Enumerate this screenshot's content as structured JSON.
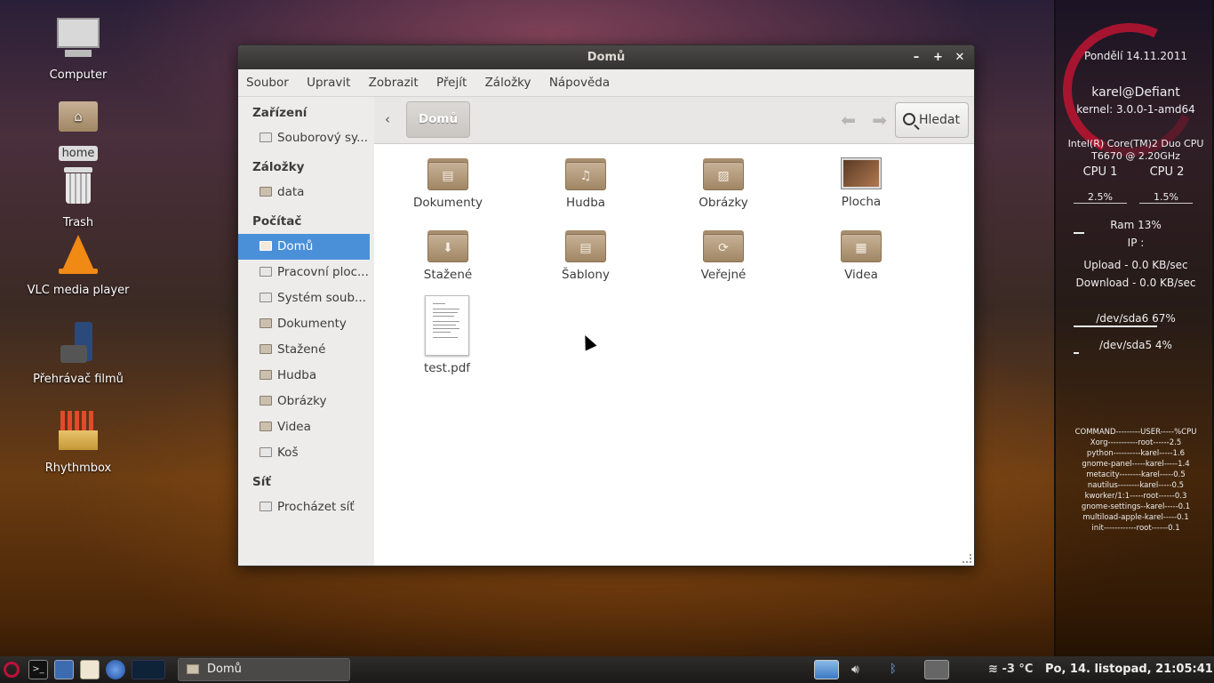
{
  "desktop": {
    "icons": [
      {
        "label": "Computer"
      },
      {
        "label": "home"
      },
      {
        "label": "Trash"
      },
      {
        "label": "VLC media player"
      },
      {
        "label": "Přehrávač filmů"
      },
      {
        "label": "Rhythmbox"
      }
    ]
  },
  "conky": {
    "date": "Pondělí 14.11.2011",
    "user": "karel@Defiant",
    "kernel": "kernel: 3.0.0-1-amd64",
    "cpu_model_line1": "Intel(R) Core(TM)2 Duo CPU",
    "cpu_model_line2": "T6670  @ 2.20GHz",
    "cpu1_label": "CPU 1",
    "cpu2_label": "CPU 2",
    "cpu1_value": "2.5%",
    "cpu2_value": "1.5%",
    "ram": "Ram 13%",
    "ram_fraction": 0.13,
    "ip": "IP :",
    "upload": "Upload - 0.0 KB/sec",
    "download": "Download - 0.0 KB/sec",
    "sda6": "/dev/sda6 67%",
    "sda6_fraction": 0.67,
    "sda5": "/dev/sda5 4%",
    "sda5_fraction": 0.04,
    "processes": [
      "COMMAND---------USER-----%CPU",
      "Xorg-----------root------2.5",
      "python----------karel-----1.6",
      "gnome-panel-----karel-----1.4",
      "metacity--------karel-----0.5",
      "nautilus--------karel-----0.5",
      "kworker/1:1-----root------0.3",
      "gnome-settings--karel-----0.1",
      "multiload-apple-karel-----0.1",
      "init------------root------0.1"
    ]
  },
  "window": {
    "title": "Domů",
    "controls": {
      "minimize": "–",
      "maximize": "+",
      "close": "✕"
    },
    "menu": [
      "Soubor",
      "Upravit",
      "Zobrazit",
      "Přejít",
      "Záložky",
      "Nápověda"
    ],
    "sidebar": {
      "section_devices": "Zařízení",
      "devices": [
        "Souborový sy..."
      ],
      "section_bookmarks": "Záložky",
      "bookmarks": [
        "data"
      ],
      "section_computer": "Počítač",
      "computer": [
        "Domů",
        "Pracovní ploc...",
        "Systém soub...",
        "Dokumenty",
        "Stažené",
        "Hudba",
        "Obrázky",
        "Videa",
        "Koš"
      ],
      "section_network": "Síť",
      "network": [
        "Procházet síť"
      ]
    },
    "toolbar": {
      "back": "‹",
      "breadcrumb": "Domů",
      "search": "Hledat"
    },
    "files": [
      {
        "name": "Dokumenty",
        "icon": "folder-documents-icon"
      },
      {
        "name": "Hudba",
        "icon": "folder-music-icon"
      },
      {
        "name": "Obrázky",
        "icon": "folder-pictures-icon"
      },
      {
        "name": "Plocha",
        "icon": "folder-desktop-icon"
      },
      {
        "name": "Stažené",
        "icon": "folder-download-icon"
      },
      {
        "name": "Šablony",
        "icon": "folder-templates-icon"
      },
      {
        "name": "Veřejné",
        "icon": "folder-public-icon"
      },
      {
        "name": "Videa",
        "icon": "folder-videos-icon"
      },
      {
        "name": "test.pdf",
        "icon": "pdf-file-icon"
      }
    ]
  },
  "taskbar": {
    "window_button": "Domů",
    "temperature": "-3 °C",
    "clock": "Po, 14. listopad, 21:05:41"
  }
}
